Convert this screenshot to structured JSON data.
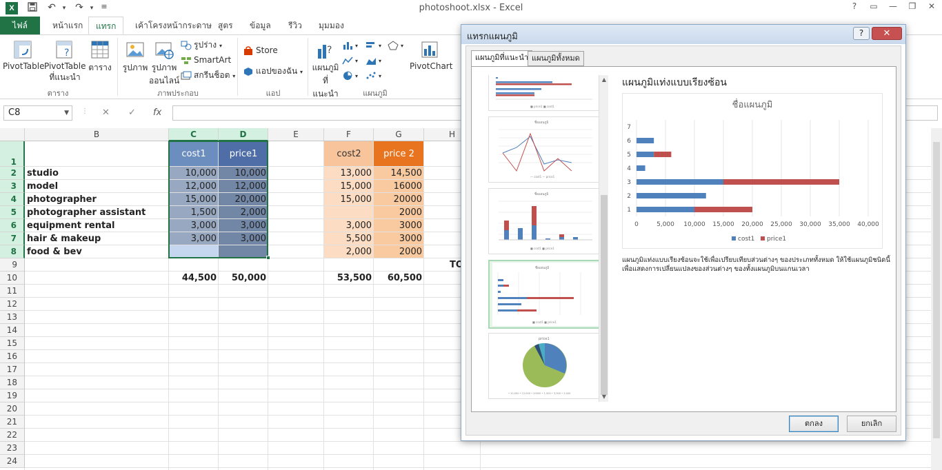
{
  "window": {
    "title": "photoshoot.xlsx - Excel",
    "app_icon": "X"
  },
  "quick_access": {
    "save_icon": "save-icon",
    "undo_icon": "undo-icon",
    "redo_icon": "redo-icon"
  },
  "tabs": [
    {
      "label": "ไฟล์"
    },
    {
      "label": "หน้าแรก"
    },
    {
      "label": "แทรก"
    },
    {
      "label": "เค้าโครงหน้ากระดาษ"
    },
    {
      "label": "สูตร"
    },
    {
      "label": "ข้อมูล"
    },
    {
      "label": "รีวิว"
    },
    {
      "label": "มุมมอง"
    }
  ],
  "ribbon": {
    "pivottable": "PivotTable",
    "recommended_pivot_1": "PivotTable",
    "recommended_pivot_2": "ที่แนะนำ",
    "table": "ตาราง",
    "picture": "รูปภาพ",
    "online_picture_1": "รูปภาพ",
    "online_picture_2": "ออนไลน์",
    "shapes": "รูปร่าง",
    "smartart": "SmartArt",
    "screenshot": "สกรีนช็อต",
    "store": "Store",
    "my_apps": "แอปของฉัน",
    "recommended_charts_1": "แผนภูมิ",
    "recommended_charts_2": "ที่แนะนำ",
    "pivotchart": "PivotChart",
    "group_tables": "ตาราง",
    "group_illustrations": "ภาพประกอบ",
    "group_apps": "แอป",
    "group_charts": "แผนภูมิ"
  },
  "formula_bar": {
    "name_box": "C8",
    "fx": "fx",
    "cancel": "✕",
    "enter": "✓"
  },
  "columns": [
    "B",
    "C",
    "D",
    "E",
    "F",
    "G",
    "H"
  ],
  "rows": [
    "1",
    "2",
    "3",
    "4",
    "5",
    "6",
    "7",
    "8",
    "9",
    "10",
    "11",
    "12",
    "13",
    "14",
    "15",
    "16",
    "17",
    "18",
    "19",
    "20",
    "21",
    "22",
    "23",
    "24"
  ],
  "sheet": {
    "headers": {
      "cost1": "cost1",
      "price1": "price1",
      "cost2": "cost2",
      "price2": "price 2"
    },
    "items": [
      {
        "name": "studio",
        "cost1": "10,000",
        "price1": "10,000",
        "cost2": "13,000",
        "price2": "14,500"
      },
      {
        "name": "model",
        "cost1": "12,000",
        "price1": "12,000",
        "cost2": "15,000",
        "price2": "16000"
      },
      {
        "name": "photographer",
        "cost1": "15,000",
        "price1": "20,000",
        "cost2": "15,000",
        "price2": "20000"
      },
      {
        "name": "photographer assistant",
        "cost1": "1,500",
        "price1": "2,000",
        "cost2": "",
        "price2": "2000"
      },
      {
        "name": "equipment rental",
        "cost1": "3,000",
        "price1": "3,000",
        "cost2": "3,000",
        "price2": "3000"
      },
      {
        "name": "hair & makeup",
        "cost1": "3,000",
        "price1": "3,000",
        "cost2": "5,500",
        "price2": "3000"
      },
      {
        "name": "food & bev",
        "cost1": "",
        "price1": "",
        "cost2": "2,000",
        "price2": "2000"
      }
    ],
    "row9_label": "TO",
    "totals": {
      "cost1": "44,500",
      "price1": "50,000",
      "cost2": "53,500",
      "price2": "60,500"
    }
  },
  "dialog": {
    "title": "แทรกแผนภูมิ",
    "help": "?",
    "close": "✕",
    "tab_recommended": "แผนภูมิที่แนะนำ",
    "tab_all": "แผนภูมิทั้งหมด",
    "preview_heading": "แผนภูมิแท่งแบบเรียงซ้อน",
    "description": "แผนภูมิแท่งแบบเรียงซ้อนจะใช้เพื่อเปรียบเทียบส่วนต่างๆ ของประเภททั้งหมด ให้ใช้แผนภูมิชนิดนี้เพื่อแสดงการเปลี่ยนแปลงของส่วนต่างๆ ของทั้งแผนภูมิบนแกนเวลา",
    "ok": "ตกลง",
    "cancel": "ยกเลิก",
    "thumb_titles": {
      "line": "ชื่อแผนภูมิ",
      "column": "ชื่อแผนภูมิ",
      "bar": "ชื่อแผนภูมิ",
      "pie": "price1"
    }
  },
  "chart_data": {
    "type": "bar",
    "stacked": true,
    "orientation": "horizontal",
    "title": "ชื่อแผนภูมิ",
    "categories": [
      "1",
      "2",
      "3",
      "4",
      "5",
      "6",
      "7"
    ],
    "series": [
      {
        "name": "cost1",
        "color": "#4f81bd",
        "values": [
          10000,
          12000,
          15000,
          1500,
          3000,
          3000,
          0
        ]
      },
      {
        "name": "price1",
        "color": "#c0504d",
        "values": [
          10000,
          0,
          20000,
          0,
          3000,
          0,
          0
        ]
      }
    ],
    "xlim": [
      0,
      40000
    ],
    "xticks": [
      "0",
      "5,000",
      "10,000",
      "15,000",
      "20,000",
      "25,000",
      "30,000",
      "35,000",
      "40,000"
    ],
    "grid": true,
    "legend": "bottom"
  }
}
